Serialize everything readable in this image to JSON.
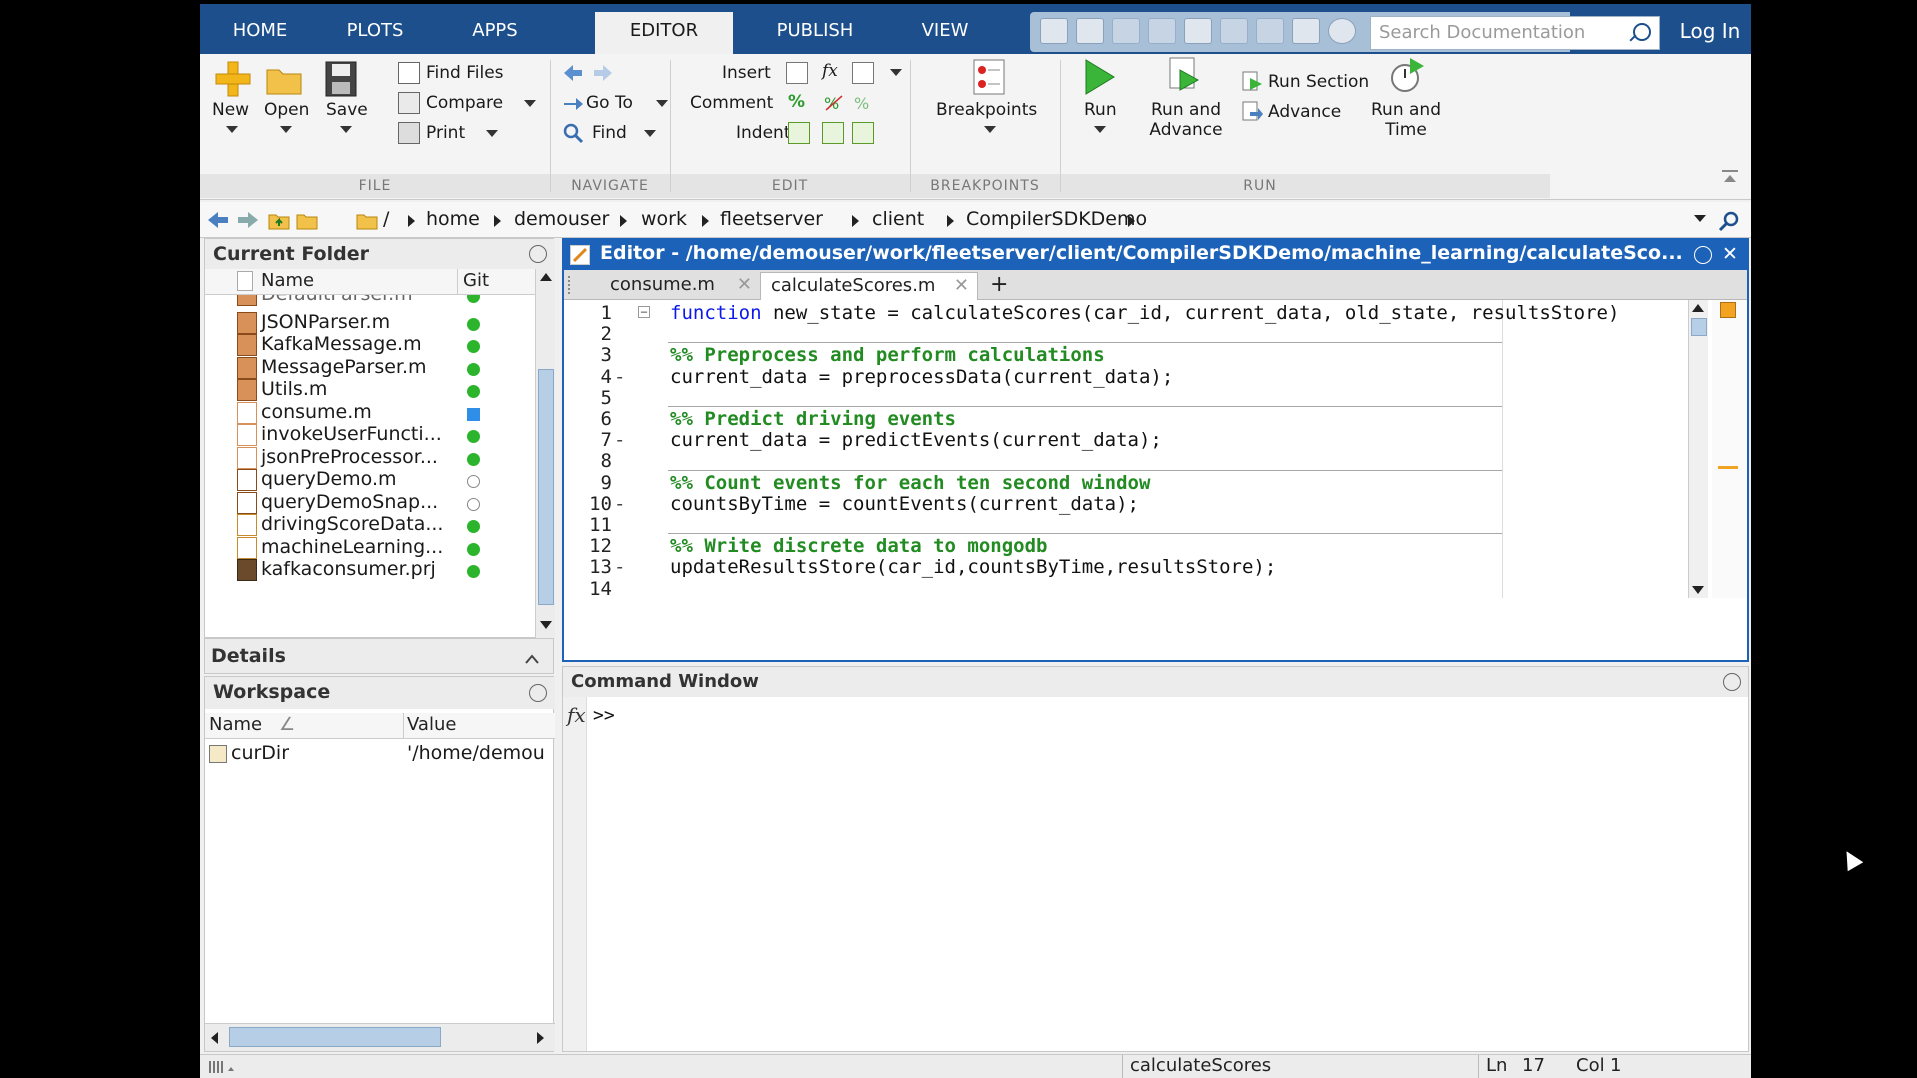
{
  "tabs": [
    "HOME",
    "PLOTS",
    "APPS",
    "EDITOR",
    "PUBLISH",
    "VIEW"
  ],
  "active_tab": "EDITOR",
  "search": {
    "placeholder": "Search Documentation"
  },
  "login_label": "Log In",
  "ribbon": {
    "file": {
      "section": "FILE",
      "new": "New",
      "open": "Open",
      "save": "Save",
      "find_files": "Find Files",
      "compare": "Compare",
      "print": "Print"
    },
    "navigate": {
      "section": "NAVIGATE",
      "go_to": "Go To",
      "find": "Find"
    },
    "edit": {
      "section": "EDIT",
      "insert": "Insert",
      "comment": "Comment",
      "indent": "Indent",
      "fx": "fx",
      "percent": "%"
    },
    "breakpoints": {
      "section": "BREAKPOINTS",
      "label": "Breakpoints"
    },
    "run": {
      "section": "RUN",
      "run": "Run",
      "run_and": "Run and",
      "advance_line": "Advance",
      "run_section": "Run Section",
      "advance": "Advance",
      "run_time_1": "Run and",
      "run_time_2": "Time"
    }
  },
  "address": {
    "root": "/",
    "crumbs": [
      "home",
      "demouser",
      "work",
      "fleetserver",
      "client",
      "CompilerSDKDemo"
    ]
  },
  "current_folder": {
    "title": "Current Folder",
    "col_name": "Name",
    "col_git": "Git",
    "partial_top": "DefaultParser.m",
    "files": [
      {
        "name": "JSONParser.m",
        "type": "class",
        "git": "g"
      },
      {
        "name": "KafkaMessage.m",
        "type": "class",
        "git": "g"
      },
      {
        "name": "MessageParser.m",
        "type": "class",
        "git": "g"
      },
      {
        "name": "Utils.m",
        "type": "class",
        "git": "g"
      },
      {
        "name": "consume.m",
        "type": "func",
        "git": "b"
      },
      {
        "name": "invokeUserFuncti...",
        "type": "func",
        "git": "g"
      },
      {
        "name": "jsonPreProcessor...",
        "type": "func",
        "git": "g"
      },
      {
        "name": "queryDemo.m",
        "type": "script",
        "git": "o"
      },
      {
        "name": "queryDemoSnap...",
        "type": "script",
        "git": "o"
      },
      {
        "name": "drivingScoreData...",
        "type": "table",
        "git": "g"
      },
      {
        "name": "machineLearning...",
        "type": "table",
        "git": "g"
      },
      {
        "name": "kafkaconsumer.prj",
        "type": "prj",
        "git": "g"
      }
    ]
  },
  "details": {
    "title": "Details"
  },
  "workspace": {
    "title": "Workspace",
    "col_name": "Name",
    "col_value": "Value",
    "sort_glyph": "∠",
    "rows": [
      {
        "name": "curDir",
        "value": "'/home/demou"
      }
    ]
  },
  "editor": {
    "title": "Editor - /home/demouser/work/fleetserver/client/CompilerSDKDemo/machine_learning/calculateSco...",
    "tabs": [
      "consume.m",
      "calculateScores.m"
    ],
    "lines": [
      {
        "n": "1",
        "kw": "function",
        "text": " new_state = calculateScores(car_id, current_data, old_state, resultsStore)",
        "fold": true
      },
      {
        "n": "2",
        "text": ""
      },
      {
        "n": "3",
        "cm": "%% Preprocess and perform calculations"
      },
      {
        "n": "4",
        "dash": true,
        "text": "current_data = preprocessData(current_data);"
      },
      {
        "n": "5",
        "text": ""
      },
      {
        "n": "6",
        "cm": "%% Predict driving events"
      },
      {
        "n": "7",
        "dash": true,
        "text": "current_data = predictEvents(current_data);"
      },
      {
        "n": "8",
        "text": ""
      },
      {
        "n": "9",
        "cm": "%% Count events for each ten second window"
      },
      {
        "n": "10",
        "dash": true,
        "text": "countsByTime = countEvents(current_data);"
      },
      {
        "n": "11",
        "text": ""
      },
      {
        "n": "12",
        "cm": "%% Write discrete data to mongodb"
      },
      {
        "n": "13",
        "dash": true,
        "text": "updateResultsStore(car_id,countsByTime,resultsStore);"
      },
      {
        "n": "14",
        "text": ""
      }
    ]
  },
  "command_window": {
    "title": "Command Window",
    "fx": "fx",
    "prompt": ">>"
  },
  "status": {
    "function": "calculateScores",
    "ln_label": "Ln",
    "ln": "17",
    "col_label": "Col",
    "col": "1"
  },
  "colors": {
    "tab_bar": "#1c4f8c",
    "editor_title": "#1c62b8",
    "comment": "#228b22",
    "keyword": "#0b1ae8"
  }
}
